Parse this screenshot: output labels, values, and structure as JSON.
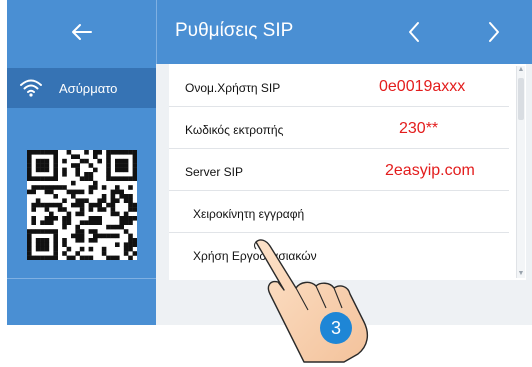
{
  "header": {
    "title": "Ρυθμίσεις SIP",
    "back_icon": "arrow-left-icon",
    "prev_icon": "chevron-left-icon",
    "next_icon": "chevron-right-icon"
  },
  "sidebar": {
    "items": [
      {
        "label": "Ασύρματο",
        "icon": "wifi-icon"
      }
    ],
    "qr_icon": "qr-code-icon"
  },
  "settings": [
    {
      "label": "Ονομ.Χρήστη SIP",
      "value": "0e0019axxx"
    },
    {
      "label": "Κωδικός εκτροπής",
      "value": "230**"
    },
    {
      "label": "Server  SIP",
      "value": "2easyip.com"
    },
    {
      "label": "Χειροκίνητη εγγραφή",
      "value": ""
    },
    {
      "label": "Χρήση Εργοστασιακών",
      "value": ""
    }
  ],
  "annotation": {
    "step": "3"
  },
  "colors": {
    "header_bg": "#4a8fd3",
    "sidebar_selected": "#3673b4",
    "value_text": "#e31d1d",
    "badge": "#1e86d6"
  }
}
